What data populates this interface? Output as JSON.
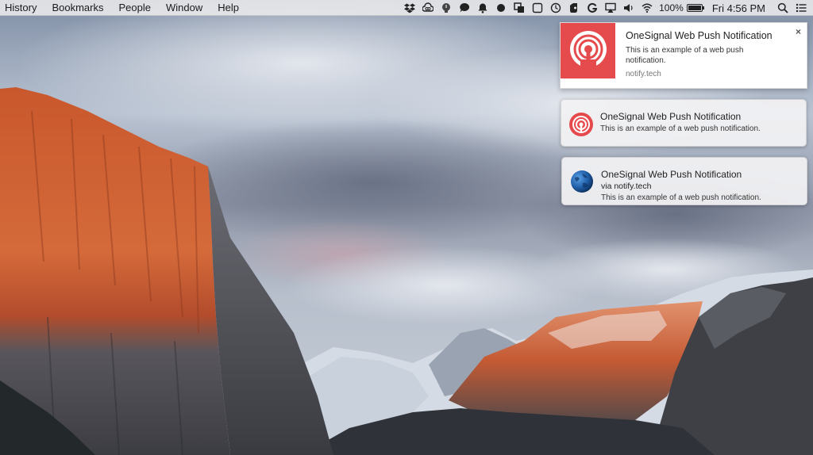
{
  "menubar": {
    "items": [
      "History",
      "Bookmarks",
      "People",
      "Window",
      "Help"
    ],
    "status_icons": [
      "dropbox-icon",
      "creative-cloud-icon",
      "lightbulb-icon",
      "chat-bubble-icon",
      "notification-bell-icon",
      "record-dot-icon",
      "screen-share-icon",
      "stop-square-icon",
      "time-machine-icon",
      "evernote-icon",
      "grammarly-icon",
      "airplay-icon",
      "volume-icon",
      "wifi-icon"
    ],
    "battery_text": "100%",
    "battery_level": 1.0,
    "clock": "Fri 4:56 PM",
    "right_icons": [
      "spotlight-search-icon",
      "notification-center-icon"
    ]
  },
  "notifications": [
    {
      "style": "chrome",
      "title": "OneSignal Web Push Notification",
      "body": "This is an example of a web push notification.",
      "site": "notify.tech",
      "close": "×",
      "icon": "onesignal-icon"
    },
    {
      "style": "mac",
      "title": "OneSignal Web Push Notification",
      "body": "This is an example of a web push notification.",
      "icon": "onesignal-icon"
    },
    {
      "style": "mac",
      "title": "OneSignal Web Push Notification",
      "subtitle": "via notify.tech",
      "body": "This is an example of a web push notification.",
      "icon": "globe-icon"
    }
  ],
  "colors": {
    "onesignal_red": "#e54b4d",
    "menubar_bg": "#ececee"
  }
}
